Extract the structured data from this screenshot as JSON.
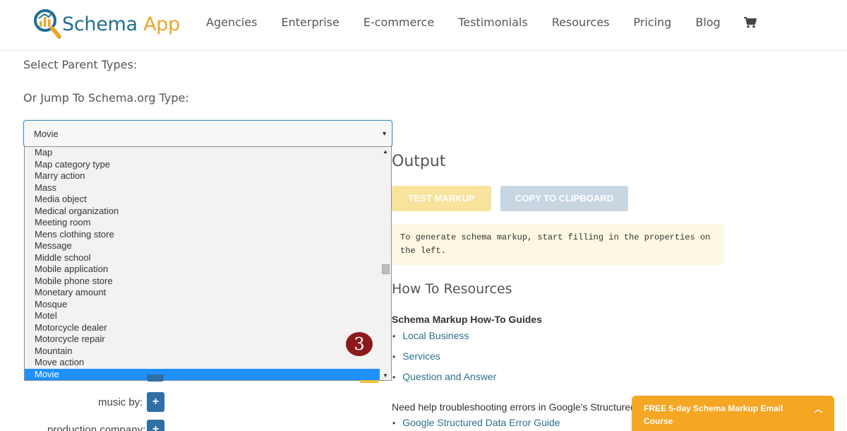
{
  "header": {
    "logo_word1": "Schema",
    "logo_word2": "App",
    "nav": [
      "Agencies",
      "Enterprise",
      "E-commerce",
      "Testimonials",
      "Resources",
      "Pricing",
      "Blog"
    ]
  },
  "form": {
    "parent_types_label": "Select Parent Types:",
    "jump_label": "Or Jump To Schema.org Type:",
    "selected_value": "Movie",
    "options": [
      "Map",
      "Map category type",
      "Marry action",
      "Mass",
      "Media object",
      "Medical organization",
      "Meeting room",
      "Mens clothing store",
      "Message",
      "Middle school",
      "Mobile application",
      "Mobile phone store",
      "Monetary amount",
      "Mosque",
      "Motel",
      "Motorcycle dealer",
      "Motorcycle repair",
      "Mountain",
      "Move action",
      "Movie"
    ],
    "selected_index": 19,
    "step_number": "3",
    "properties": {
      "music_by": "music by:",
      "production_company": "production company:",
      "add_label": "+"
    }
  },
  "output": {
    "title": "Output",
    "test_button": "TEST MARKUP",
    "copy_button": "COPY TO CLIPBOARD",
    "hint": "To generate schema markup, start filling in the properties on the left."
  },
  "resources": {
    "title": "How To Resources",
    "guides_title": "Schema Markup How-To Guides",
    "guides": [
      "Local Business",
      "Services",
      "Question and Answer"
    ],
    "help_text": "Need help troubleshooting errors in Google's Structured Data Testing Tool?",
    "error_guide": "Google Structured Data Error Guide"
  },
  "promo": {
    "text": "FREE 5-day Schema Markup Email Course"
  },
  "colors": {
    "brand_blue": "#1f6f8f",
    "brand_orange": "#e8a72b",
    "selected_option": "#1e90ff",
    "promo": "#f5a623",
    "plus_button": "#2f6fa6"
  },
  "icons": [
    "magnifier-chart-logo-icon",
    "cart-icon",
    "dropdown-caret-icon",
    "scroll-up-icon",
    "scroll-down-icon",
    "chevron-up-icon"
  ]
}
